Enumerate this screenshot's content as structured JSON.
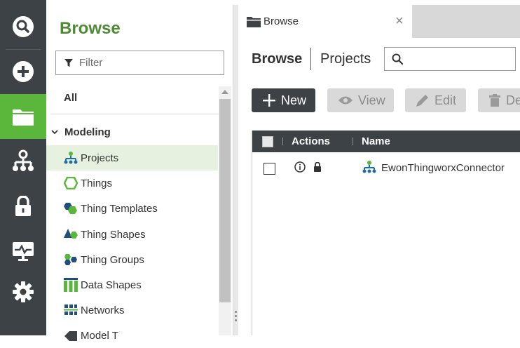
{
  "rail": {
    "items": [
      {
        "icon": "search-icon"
      },
      {
        "icon": "add-icon"
      },
      {
        "icon": "folder-icon",
        "active": true
      },
      {
        "icon": "hierarchy-icon"
      },
      {
        "icon": "lock-icon"
      },
      {
        "icon": "monitor-icon"
      },
      {
        "icon": "gear-icon"
      }
    ],
    "active_color": "#5bb73b",
    "bg_color": "#3c4245"
  },
  "browse": {
    "title": "Browse",
    "filter_placeholder": "Filter",
    "all_label": "All",
    "section_label": "Modeling",
    "items": [
      {
        "label": "Projects",
        "icon": "projects-icon",
        "selected": true
      },
      {
        "label": "Things",
        "icon": "things-icon"
      },
      {
        "label": "Thing Templates",
        "icon": "thing-templates-icon"
      },
      {
        "label": "Thing Shapes",
        "icon": "thing-shapes-icon"
      },
      {
        "label": "Thing Groups",
        "icon": "thing-groups-icon"
      },
      {
        "label": "Data Shapes",
        "icon": "data-shapes-icon"
      },
      {
        "label": "Networks",
        "icon": "networks-icon"
      },
      {
        "label": "Model T",
        "icon": "model-tags-icon"
      }
    ]
  },
  "tab": {
    "label": "Browse",
    "close": "×"
  },
  "breadcrumb": {
    "root": "Browse",
    "current": "Projects"
  },
  "search": {
    "placeholder": ""
  },
  "toolbar": {
    "new_label": "New",
    "view_label": "View",
    "edit_label": "Edit",
    "delete_label": "De"
  },
  "grid": {
    "columns": [
      "Actions",
      "Name"
    ],
    "rows": [
      {
        "name": "EwonThingworxConnector"
      }
    ]
  }
}
